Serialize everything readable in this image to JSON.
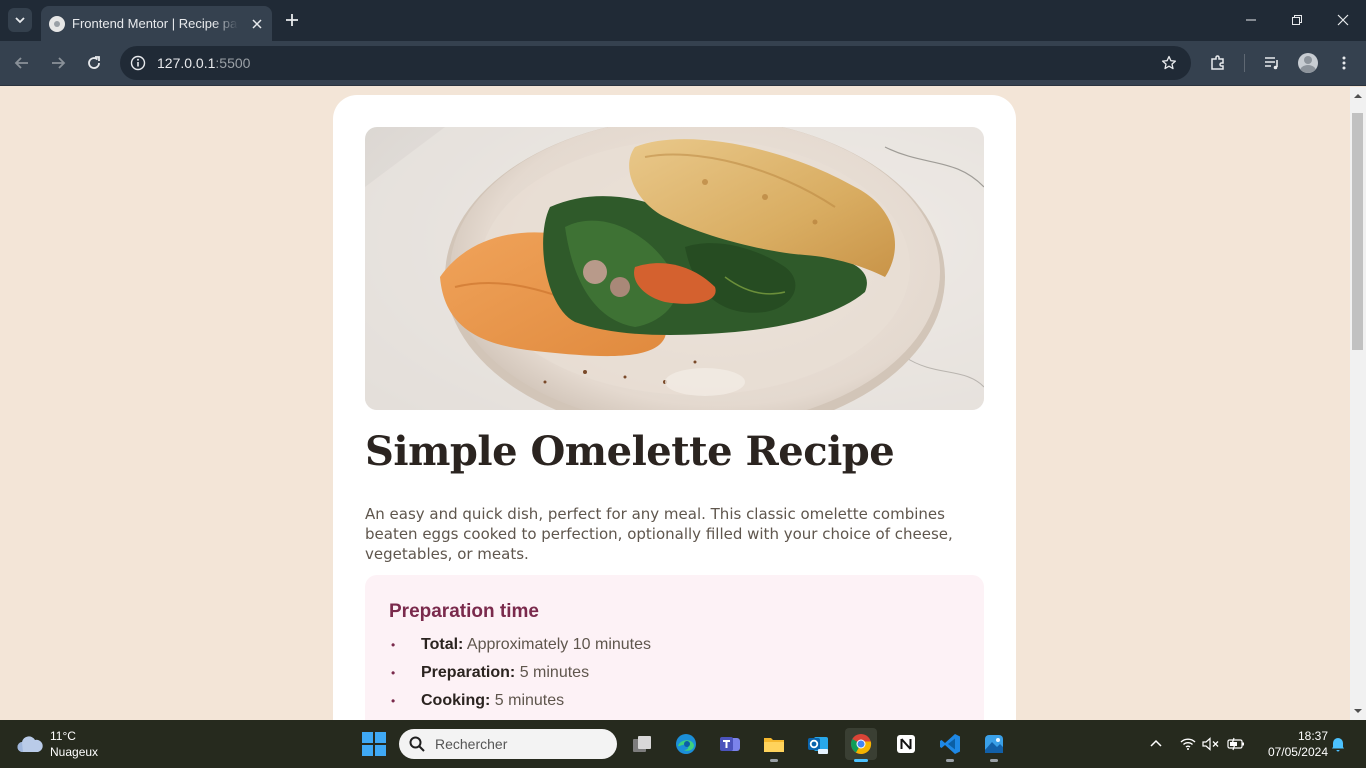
{
  "browser": {
    "tab_title": "Frontend Mentor | Recipe page",
    "url_host": "127.0.0.1",
    "url_port": ":5500"
  },
  "recipe": {
    "title": "Simple Omelette Recipe",
    "description": "An easy and quick dish, perfect for any meal. This classic omelette combines beaten eggs cooked to perfection, optionally filled with your choice of cheese, vegetables, or meats.",
    "prep_heading": "Preparation time",
    "prep_items": [
      {
        "label": "Total:",
        "value": " Approximately 10 minutes"
      },
      {
        "label": "Preparation:",
        "value": " 5 minutes"
      },
      {
        "label": "Cooking:",
        "value": " 5 minutes"
      }
    ],
    "colors": {
      "background": "#f3e5d7",
      "accent": "#7a2a4c",
      "heading": "#2b2420"
    }
  },
  "taskbar": {
    "weather_temp": "11°C",
    "weather_desc": "Nuageux",
    "search_placeholder": "Rechercher",
    "time": "18:37",
    "date": "07/05/2024"
  }
}
